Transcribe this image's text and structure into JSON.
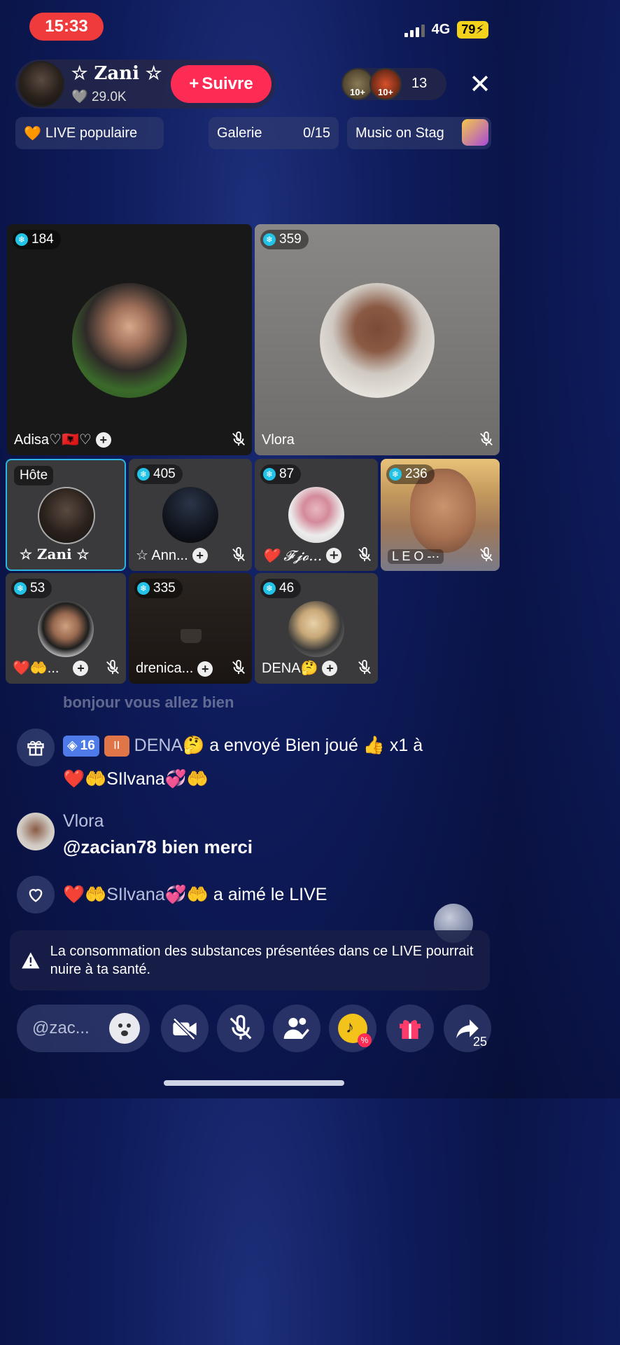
{
  "status_bar": {
    "time": "15:33",
    "network": "4G",
    "battery": "79"
  },
  "host": {
    "name": "☆ Zani ☆",
    "likes": "29.0K",
    "follow_label": "Suivre"
  },
  "viewers": {
    "badge1": "10+",
    "badge2": "10+",
    "count": "13"
  },
  "chips": {
    "live_popular": "LIVE populaire",
    "gallery_label": "Galerie",
    "gallery_count": "0/15",
    "music": "Music on Stag"
  },
  "guests": {
    "adisa": {
      "count": "184",
      "name": "Adisa♡🇦🇱♡"
    },
    "vlora": {
      "count": "359",
      "name": "Vlora"
    },
    "host_tile": {
      "tag": "Hôte",
      "name": "☆ Zani ☆"
    },
    "ann": {
      "count": "405",
      "name": "☆ Ann..."
    },
    "fjo": {
      "count": "87",
      "name": "❤️ 𝓕𝓳𝓸..."
    },
    "leo": {
      "count": "236",
      "name": "L E O -··"
    },
    "silvana": {
      "count": "53",
      "name": "❤️🤲..."
    },
    "drenica": {
      "count": "335",
      "name": "drenica..."
    },
    "dena": {
      "count": "46",
      "name": "DENA🤔"
    }
  },
  "chat": {
    "faded": "bonjour vous allez bien",
    "gift": {
      "level": "16",
      "level2_icon": "II",
      "sender": "DENA🤔",
      "text": " a envoyé Bien joué 👍 x1 à",
      "recipient": "❤️🤲SIlvana💞🤲"
    },
    "comment": {
      "user": "Vlora",
      "text": "@zacian78 bien merci"
    },
    "like": {
      "user": "❤️🤲SIlvana💞🤲",
      "text": " a aimé le LIVE"
    }
  },
  "warning": "La consommation des substances présentées dans ce LIVE pourrait nuire à ta santé.",
  "bottom_bar": {
    "comment_placeholder": "@zac...",
    "share_count": "25"
  },
  "colors": {
    "follow": "#fe2c55",
    "time_pill": "#ef3b3b",
    "battery": "#f2d21b",
    "host_border": "#2bb6e0"
  }
}
